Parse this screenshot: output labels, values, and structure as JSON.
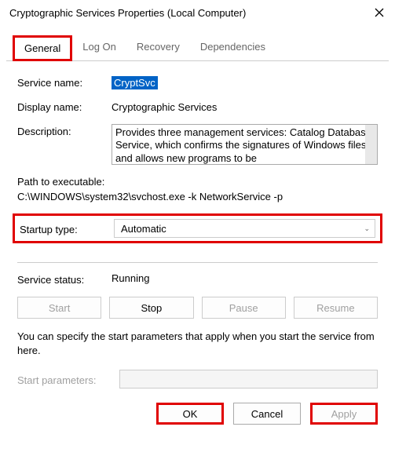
{
  "window": {
    "title": "Cryptographic Services Properties (Local Computer)"
  },
  "tabs": {
    "general": "General",
    "logon": "Log On",
    "recovery": "Recovery",
    "dependencies": "Dependencies"
  },
  "labels": {
    "service_name": "Service name:",
    "display_name": "Display name:",
    "description": "Description:",
    "path_heading": "Path to executable:",
    "startup_type": "Startup type:",
    "service_status": "Service status:",
    "start_parameters": "Start parameters:"
  },
  "values": {
    "service_name": "CryptSvc",
    "display_name": "Cryptographic Services",
    "description": "Provides three management services: Catalog Database Service, which confirms the signatures of Windows files and allows new programs to be",
    "path": "C:\\WINDOWS\\system32\\svchost.exe -k NetworkService -p",
    "startup_type": "Automatic",
    "service_status": "Running",
    "start_parameters": ""
  },
  "hint": "You can specify the start parameters that apply when you start the service from here.",
  "buttons": {
    "start": "Start",
    "stop": "Stop",
    "pause": "Pause",
    "resume": "Resume",
    "ok": "OK",
    "cancel": "Cancel",
    "apply": "Apply"
  }
}
